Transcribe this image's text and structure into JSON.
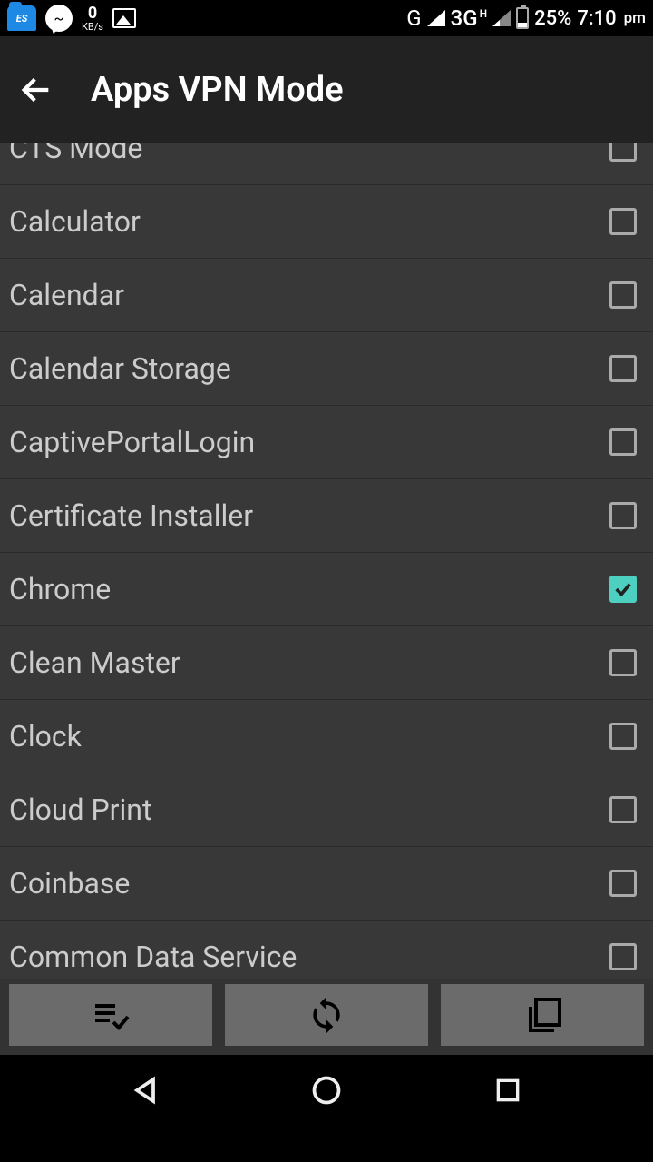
{
  "status": {
    "kbs_value": "0",
    "kbs_label": "KB/s",
    "network_g": "G",
    "network_3g": "3G",
    "network_h": "H",
    "battery": "25%",
    "time": "7:10",
    "time_suffix": "pm"
  },
  "header": {
    "title": "Apps VPN Mode"
  },
  "apps": [
    {
      "name": "CTS Mode",
      "checked": false
    },
    {
      "name": "Calculator",
      "checked": false
    },
    {
      "name": "Calendar",
      "checked": false
    },
    {
      "name": "Calendar Storage",
      "checked": false
    },
    {
      "name": "CaptivePortalLogin",
      "checked": false
    },
    {
      "name": "Certificate Installer",
      "checked": false
    },
    {
      "name": "Chrome",
      "checked": true
    },
    {
      "name": "Clean Master",
      "checked": false
    },
    {
      "name": "Clock",
      "checked": false
    },
    {
      "name": "Cloud Print",
      "checked": false
    },
    {
      "name": "Coinbase",
      "checked": false
    },
    {
      "name": "Common Data Service",
      "checked": false
    }
  ],
  "colors": {
    "accent": "#4dd0c0",
    "bg_dark": "#222",
    "bg_list": "#383838"
  }
}
